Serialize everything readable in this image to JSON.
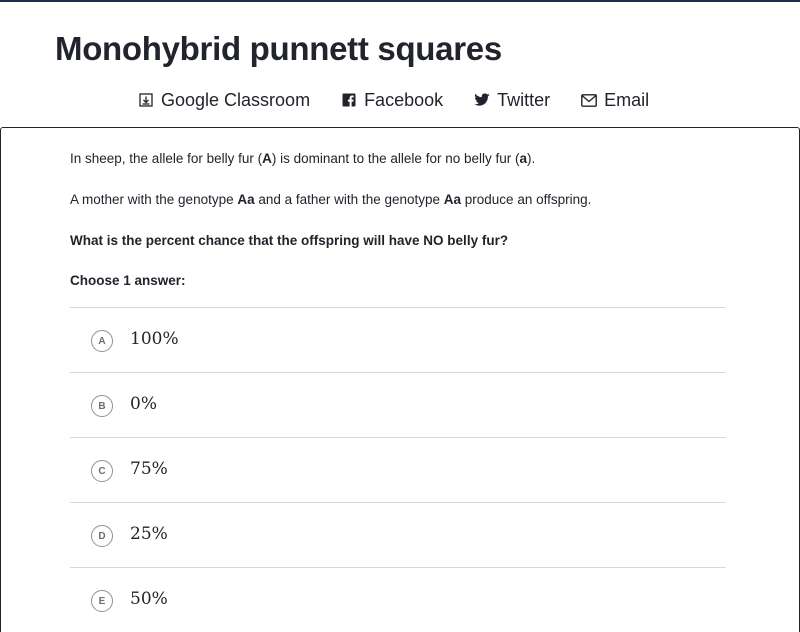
{
  "title": "Monohybrid punnett squares",
  "share": [
    {
      "label": "Google Classroom",
      "icon": "google-classroom-icon"
    },
    {
      "label": "Facebook",
      "icon": "facebook-icon"
    },
    {
      "label": "Twitter",
      "icon": "twitter-icon"
    },
    {
      "label": "Email",
      "icon": "email-icon"
    }
  ],
  "question": {
    "p1": {
      "t1": "In sheep, the allele for belly fur (",
      "b1": "A",
      "t2": ") is dominant to the allele for no belly fur (",
      "b2": "a",
      "t3": ")."
    },
    "p2": {
      "t1": "A mother with the genotype ",
      "b1": "Aa",
      "t2": " and a father with the genotype ",
      "b2": "Aa",
      "t3": " produce an offspring."
    },
    "prompt": "What is the percent chance that the offspring will have NO belly fur?",
    "instruction": "Choose 1 answer:"
  },
  "choices": [
    {
      "letter": "A",
      "value": "100%"
    },
    {
      "letter": "B",
      "value": "0%"
    },
    {
      "letter": "C",
      "value": "75%"
    },
    {
      "letter": "D",
      "value": "25%"
    },
    {
      "letter": "E",
      "value": "50%"
    }
  ],
  "colors": {
    "text": "#21242c",
    "divider": "#d6d8da",
    "top_rule": "#1c2d4a",
    "circle": "#8e9195"
  }
}
